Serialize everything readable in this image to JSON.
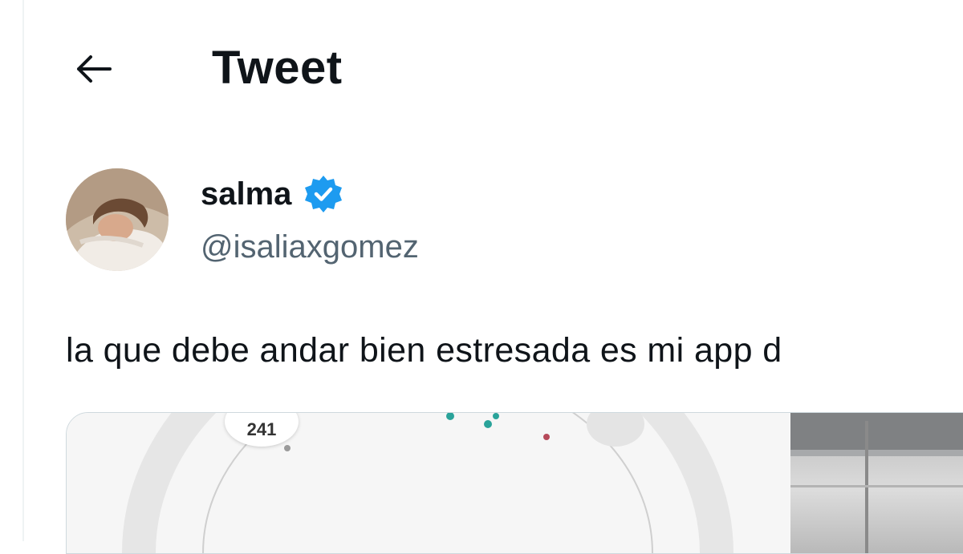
{
  "header": {
    "title": "Tweet",
    "back_icon": "arrow-left-icon"
  },
  "author": {
    "display_name": "salma",
    "handle": "@isaliaxgomez",
    "verified_icon": "verified-badge-icon",
    "verified_color": "#1d9bf0"
  },
  "tweet": {
    "text": "la que debe andar bien estresada es mi app d"
  },
  "media": {
    "count_label": "241"
  },
  "colors": {
    "text": "#0f1419",
    "muted": "#536471",
    "border": "#cfd9de"
  }
}
